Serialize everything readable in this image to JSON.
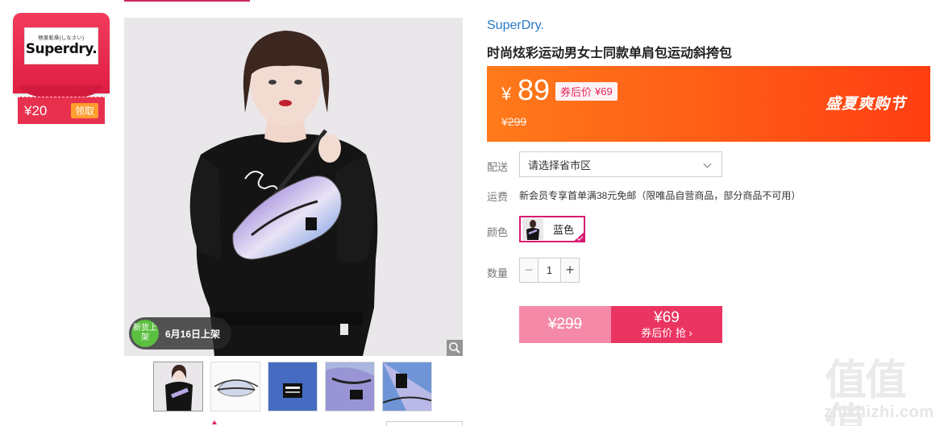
{
  "store_coupon": {
    "logo_small": "極度乾燥(しなさい)",
    "logo_text": "Superdry.",
    "amount": "¥20",
    "claim_label": "领取"
  },
  "gallery": {
    "launch_badge": {
      "circle_text": "新货上架",
      "date_text": "6月16日上架"
    },
    "thumbnail_count": 5
  },
  "product": {
    "brand": "SuperDry.",
    "title": "时尚炫彩运动男女士同款单肩包运动斜挎包",
    "price": {
      "currency": "¥",
      "current": "89",
      "after_coupon_label": "券后价",
      "after_coupon_value": "¥69",
      "original": "¥299",
      "promo": "盛夏爽购节"
    },
    "delivery": {
      "label": "配送",
      "placeholder": "请选择省市区"
    },
    "shipping": {
      "label": "运费",
      "text": "新会员专享首单满38元免邮（限唯品自营商品，部分商品不可用）"
    },
    "color": {
      "label": "颜色",
      "selected": "蓝色"
    },
    "quantity": {
      "label": "数量",
      "minus": "−",
      "value": "1",
      "plus": "+"
    },
    "buy": {
      "original": "¥299",
      "price": "¥69",
      "sub": "券后价 抢 ›"
    }
  },
  "watermark": {
    "glyphs": "值值值",
    "text": "zhizhizhi.com"
  },
  "colors": {
    "accent": "#e0245e",
    "banner_start": "#ff7a1a",
    "banner_end": "#ff3d12",
    "brand_link": "#2a7ac9",
    "badge_green": "#5bbf3f"
  }
}
